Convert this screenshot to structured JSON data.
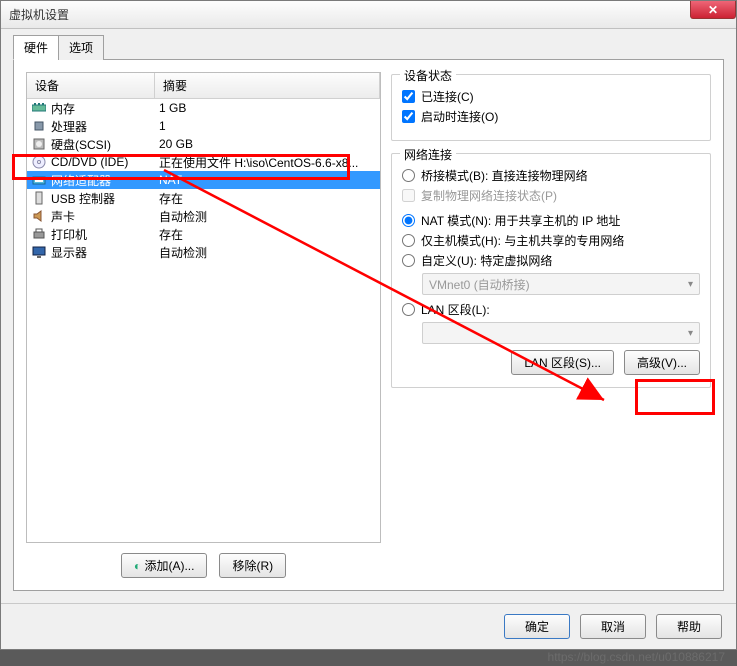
{
  "window": {
    "title": "虚拟机设置"
  },
  "tabs": {
    "hardware": "硬件",
    "options": "选项"
  },
  "hw_header": {
    "device": "设备",
    "summary": "摘要"
  },
  "hw_items": [
    {
      "device": "内存",
      "summary": "1 GB",
      "icon": "memory"
    },
    {
      "device": "处理器",
      "summary": "1",
      "icon": "cpu"
    },
    {
      "device": "硬盘(SCSI)",
      "summary": "20 GB",
      "icon": "disk"
    },
    {
      "device": "CD/DVD (IDE)",
      "summary": "正在使用文件 H:\\iso\\CentOS-6.6-x8...",
      "icon": "cd"
    },
    {
      "device": "网络适配器",
      "summary": "NAT",
      "icon": "net",
      "selected": true
    },
    {
      "device": "USB 控制器",
      "summary": "存在",
      "icon": "usb"
    },
    {
      "device": "声卡",
      "summary": "自动检测",
      "icon": "sound"
    },
    {
      "device": "打印机",
      "summary": "存在",
      "icon": "printer"
    },
    {
      "device": "显示器",
      "summary": "自动检测",
      "icon": "display"
    }
  ],
  "left_buttons": {
    "add": "添加(A)...",
    "remove": "移除(R)"
  },
  "device_status": {
    "title": "设备状态",
    "connected": "已连接(C)",
    "connect_at_power_on": "启动时连接(O)"
  },
  "network": {
    "title": "网络连接",
    "bridged": "桥接模式(B): 直接连接物理网络",
    "replicate": "复制物理网络连接状态(P)",
    "nat": "NAT 模式(N): 用于共享主机的 IP 地址",
    "hostonly": "仅主机模式(H): 与主机共享的专用网络",
    "custom": "自定义(U): 特定虚拟网络",
    "custom_value": "VMnet0 (自动桥接)",
    "lan": "LAN 区段(L):",
    "lan_value": "",
    "lan_segments_btn": "LAN 区段(S)...",
    "advanced_btn": "高级(V)..."
  },
  "dialog_buttons": {
    "ok": "确定",
    "cancel": "取消",
    "help": "帮助"
  },
  "close_icon": "✕",
  "watermark": "https://blog.csdn.net/u010886217"
}
